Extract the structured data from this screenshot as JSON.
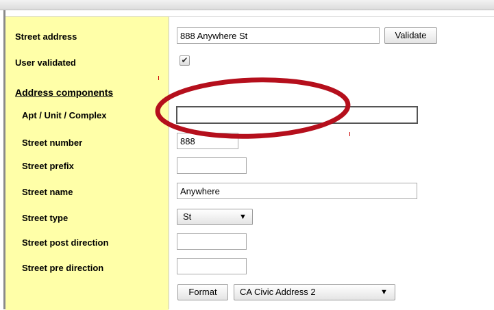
{
  "form": {
    "street_address_label": "Street address",
    "street_address_value": "888 Anywhere St",
    "validate_label": "Validate",
    "user_validated_label": "User validated",
    "user_validated_checked": true,
    "check_glyph": "✔",
    "address_components_label": "Address components",
    "apt_label": "Apt / Unit / Complex",
    "apt_value": "",
    "street_number_label": "Street number",
    "street_number_value": "888",
    "street_prefix_label": "Street prefix",
    "street_prefix_value": "",
    "street_name_label": "Street name",
    "street_name_value": "Anywhere",
    "street_type_label": "Street type",
    "street_type_value": "St",
    "street_post_direction_label": "Street post direction",
    "street_post_direction_value": "",
    "street_pre_direction_label": "Street pre direction",
    "street_pre_direction_value": "",
    "format_label": "Format",
    "format_select_value": "CA Civic Address 2",
    "dropdown_glyph": "▼"
  },
  "colors": {
    "label_column_bg": "#ffffa8",
    "annotation_ellipse": "#b50f1c"
  }
}
